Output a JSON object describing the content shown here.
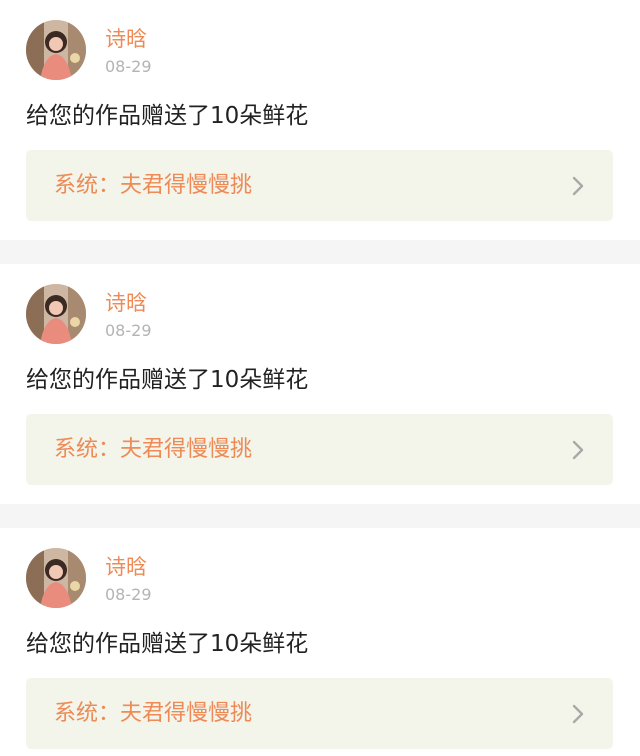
{
  "notifications": [
    {
      "user": "诗晗",
      "date": "08-29",
      "message": "给您的作品赠送了10朵鲜花",
      "source": "系统：夫君得慢慢挑",
      "avatar_icon": "avatar-photo",
      "arrow_icon": "chevron-right-icon"
    },
    {
      "user": "诗晗",
      "date": "08-29",
      "message": "给您的作品赠送了10朵鲜花",
      "source": "系统：夫君得慢慢挑",
      "avatar_icon": "avatar-photo",
      "arrow_icon": "chevron-right-icon"
    },
    {
      "user": "诗晗",
      "date": "08-29",
      "message": "给您的作品赠送了10朵鲜花",
      "source": "系统：夫君得慢慢挑",
      "avatar_icon": "avatar-photo",
      "arrow_icon": "chevron-right-icon"
    }
  ],
  "colors": {
    "accent": "#ee8a55",
    "muted": "#b4b4b4",
    "text": "#222222",
    "source_bg": "#f3f4ea",
    "divider": "#f5f5f5"
  }
}
